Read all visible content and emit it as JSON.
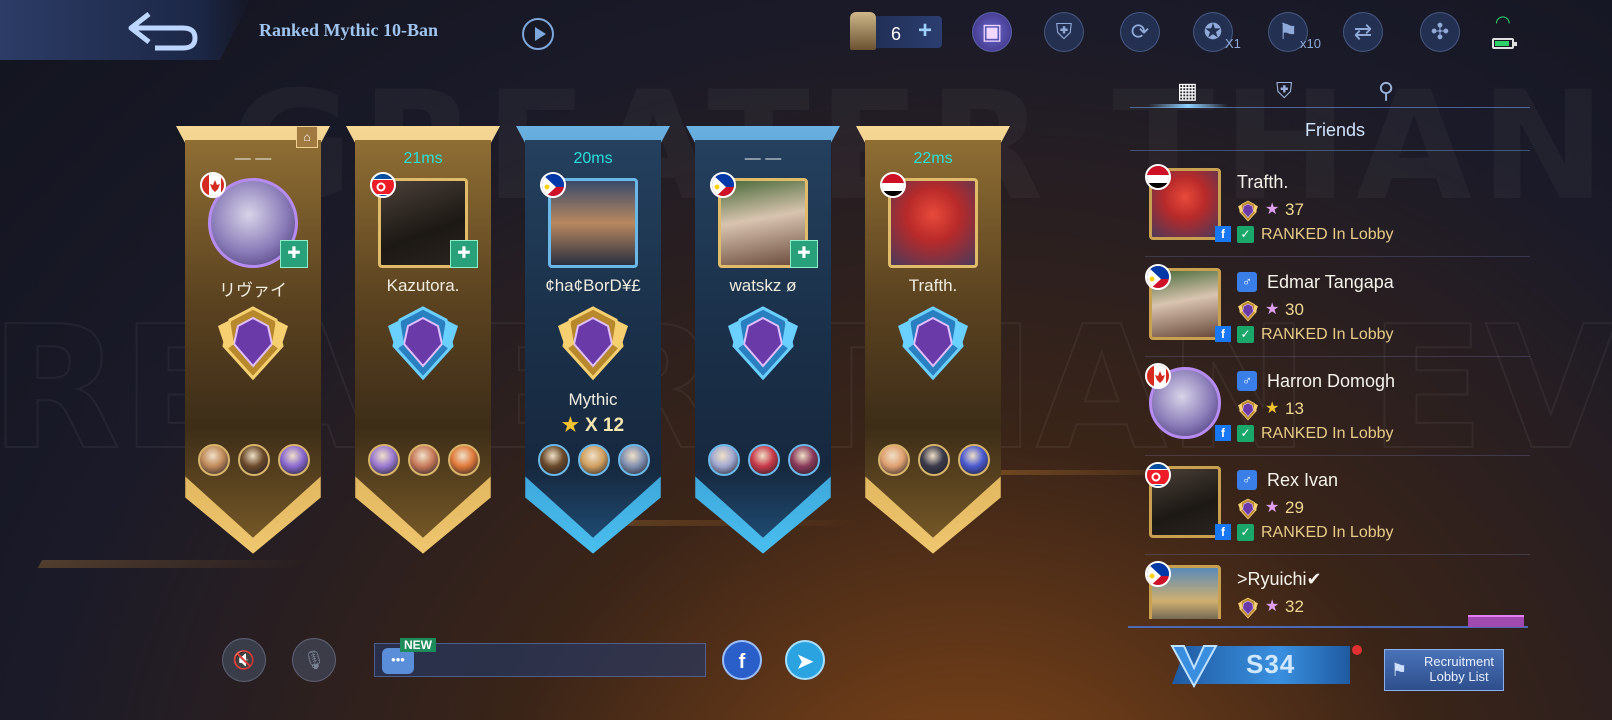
{
  "header": {
    "mode_title": "Ranked Mythic 10-Ban",
    "ticket_count": "6",
    "ticket_plus": "+",
    "icon_multipliers": [
      "X1",
      "x10"
    ]
  },
  "colors": {
    "ping": "#28e0d8",
    "accent_gold": "#e0bc6a",
    "accent_blue": "#6ab8e8",
    "online_green": "#2fd06a"
  },
  "players": [
    {
      "ping": "— —",
      "name": "リヴァイ",
      "flag": "canada",
      "avatar_style": "fancy",
      "banner": "gold",
      "show_add": true,
      "is_host": true,
      "heroes": 3
    },
    {
      "ping": "21ms",
      "name": "Kazutora.",
      "flag": "north-korea",
      "avatar_style": "gold",
      "banner": "gold",
      "show_add": true,
      "is_host": false,
      "heroes": 3
    },
    {
      "ping": "20ms",
      "name": "¢ha¢BorD¥£",
      "flag": "philippines",
      "avatar_style": "blue",
      "banner": "blue",
      "show_add": false,
      "is_host": false,
      "rank_label": "Mythic",
      "rank_stars": "X 12",
      "heroes": 3
    },
    {
      "ping": "— —",
      "name": "watskz ø",
      "flag": "philippines",
      "avatar_style": "gold",
      "banner": "blue",
      "show_add": true,
      "is_host": false,
      "heroes": 3
    },
    {
      "ping": "22ms",
      "name": "Trafth.",
      "flag": "yemen",
      "avatar_style": "gold",
      "banner": "gold",
      "show_add": false,
      "is_host": false,
      "heroes": 3
    }
  ],
  "right_panel": {
    "tabs": [
      "grid-icon",
      "shield-icon",
      "location-pin-icon"
    ],
    "friends_title": "Friends",
    "friends": [
      {
        "name": "Trafth.",
        "stars": "37",
        "status": "RANKED In Lobby",
        "flag": "yemen",
        "has_gender": false,
        "star_color": "pink"
      },
      {
        "name": "Edmar Tangapa",
        "stars": "30",
        "status": "RANKED In Lobby",
        "flag": "philippines",
        "has_gender": true,
        "star_color": "pink"
      },
      {
        "name": "Harron Domogh",
        "stars": "13",
        "status": "RANKED In Lobby",
        "flag": "canada",
        "has_gender": true,
        "star_color": "gold"
      },
      {
        "name": "Rex Ivan",
        "stars": "29",
        "status": "RANKED In Lobby",
        "flag": "north-korea",
        "has_gender": true,
        "star_color": "pink"
      },
      {
        "name": ">Ryuichi✔",
        "stars": "32",
        "status": "",
        "flag": "philippines",
        "has_gender": false,
        "star_color": "pink"
      }
    ]
  },
  "bottom": {
    "chat_new_badge": "NEW",
    "season_label": "S34",
    "recruit_label": "Recruitment Lobby List"
  }
}
